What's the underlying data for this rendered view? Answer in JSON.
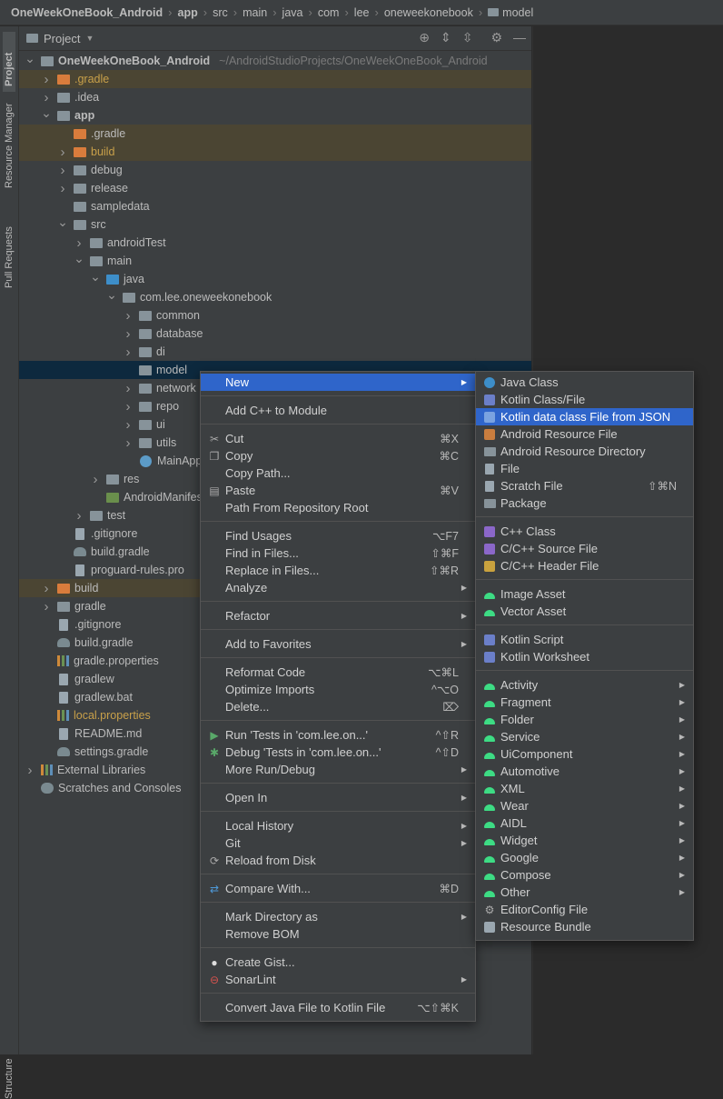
{
  "breadcrumb": [
    "OneWeekOneBook_Android",
    "app",
    "src",
    "main",
    "java",
    "com",
    "lee",
    "oneweekonebook",
    "model"
  ],
  "side_tabs": {
    "project": "Project",
    "resource_manager": "Resource Manager",
    "pull_requests": "Pull Requests",
    "structure": "Structure"
  },
  "panel": {
    "title": "Project"
  },
  "tree": [
    {
      "label": "OneWeekOneBook_Android",
      "extra": "~/AndroidStudioProjects/OneWeekOneBook_Android",
      "indent": 0,
      "arrow": "open",
      "icon": "gray",
      "bold": true
    },
    {
      "label": ".gradle",
      "indent": 1,
      "arrow": "closed",
      "icon": "orange",
      "excluded": true,
      "color": "yellow"
    },
    {
      "label": ".idea",
      "indent": 1,
      "arrow": "closed",
      "icon": "gray"
    },
    {
      "label": "app",
      "indent": 1,
      "arrow": "open",
      "icon": "gray",
      "bold": true
    },
    {
      "label": ".gradle",
      "indent": 2,
      "arrow": "none",
      "icon": "orange",
      "excluded": true
    },
    {
      "label": "build",
      "indent": 2,
      "arrow": "closed",
      "icon": "orange",
      "excluded": true,
      "color": "yellow"
    },
    {
      "label": "debug",
      "indent": 2,
      "arrow": "closed",
      "icon": "gray"
    },
    {
      "label": "release",
      "indent": 2,
      "arrow": "closed",
      "icon": "gray"
    },
    {
      "label": "sampledata",
      "indent": 2,
      "arrow": "none",
      "icon": "gray"
    },
    {
      "label": "src",
      "indent": 2,
      "arrow": "open",
      "icon": "gray"
    },
    {
      "label": "androidTest",
      "indent": 3,
      "arrow": "closed",
      "icon": "gray"
    },
    {
      "label": "main",
      "indent": 3,
      "arrow": "open",
      "icon": "gray"
    },
    {
      "label": "java",
      "indent": 4,
      "arrow": "open",
      "icon": "blue"
    },
    {
      "label": "com.lee.oneweekonebook",
      "indent": 5,
      "arrow": "open",
      "icon": "gray"
    },
    {
      "label": "common",
      "indent": 6,
      "arrow": "closed",
      "icon": "gray"
    },
    {
      "label": "database",
      "indent": 6,
      "arrow": "closed",
      "icon": "gray"
    },
    {
      "label": "di",
      "indent": 6,
      "arrow": "closed",
      "icon": "gray"
    },
    {
      "label": "model",
      "indent": 6,
      "arrow": "none",
      "icon": "gray",
      "selected": true
    },
    {
      "label": "network",
      "indent": 6,
      "arrow": "closed",
      "icon": "gray"
    },
    {
      "label": "repo",
      "indent": 6,
      "arrow": "closed",
      "icon": "gray"
    },
    {
      "label": "ui",
      "indent": 6,
      "arrow": "closed",
      "icon": "gray"
    },
    {
      "label": "utils",
      "indent": 6,
      "arrow": "closed",
      "icon": "gray"
    },
    {
      "label": "MainApp",
      "indent": 6,
      "arrow": "none",
      "icon": "kt"
    },
    {
      "label": "res",
      "indent": 4,
      "arrow": "closed",
      "icon": "gray"
    },
    {
      "label": "AndroidManifes",
      "indent": 4,
      "arrow": "none",
      "icon": "manifest"
    },
    {
      "label": "test",
      "indent": 3,
      "arrow": "closed",
      "icon": "gray"
    },
    {
      "label": ".gitignore",
      "indent": 2,
      "arrow": "none",
      "icon": "file"
    },
    {
      "label": "build.gradle",
      "indent": 2,
      "arrow": "none",
      "icon": "elephant"
    },
    {
      "label": "proguard-rules.pro",
      "indent": 2,
      "arrow": "none",
      "icon": "file"
    },
    {
      "label": "build",
      "indent": 1,
      "arrow": "closed",
      "icon": "orange",
      "excluded": true
    },
    {
      "label": "gradle",
      "indent": 1,
      "arrow": "closed",
      "icon": "gray"
    },
    {
      "label": ".gitignore",
      "indent": 1,
      "arrow": "none",
      "icon": "file"
    },
    {
      "label": "build.gradle",
      "indent": 1,
      "arrow": "none",
      "icon": "elephant"
    },
    {
      "label": "gradle.properties",
      "indent": 1,
      "arrow": "none",
      "icon": "bars"
    },
    {
      "label": "gradlew",
      "indent": 1,
      "arrow": "none",
      "icon": "file"
    },
    {
      "label": "gradlew.bat",
      "indent": 1,
      "arrow": "none",
      "icon": "file"
    },
    {
      "label": "local.properties",
      "indent": 1,
      "arrow": "none",
      "icon": "bars",
      "color": "yellow"
    },
    {
      "label": "README.md",
      "indent": 1,
      "arrow": "none",
      "icon": "file"
    },
    {
      "label": "settings.gradle",
      "indent": 1,
      "arrow": "none",
      "icon": "elephant"
    },
    {
      "label": "External Libraries",
      "indent": 0,
      "arrow": "closed",
      "icon": "bars"
    },
    {
      "label": "Scratches and Consoles",
      "indent": 0,
      "arrow": "none",
      "icon": "scratch"
    }
  ],
  "context_menu": [
    {
      "label": "New",
      "submenu": true,
      "active": true
    },
    {
      "sep": true
    },
    {
      "label": "Add C++ to Module"
    },
    {
      "sep": true
    },
    {
      "label": "Cut",
      "shortcut": "⌘X",
      "icon": "✂"
    },
    {
      "label": "Copy",
      "shortcut": "⌘C",
      "icon": "❐"
    },
    {
      "label": "Copy Path..."
    },
    {
      "label": "Paste",
      "shortcut": "⌘V",
      "icon": "▤"
    },
    {
      "label": "Path From Repository Root"
    },
    {
      "sep": true
    },
    {
      "label": "Find Usages",
      "shortcut": "⌥F7"
    },
    {
      "label": "Find in Files...",
      "shortcut": "⇧⌘F"
    },
    {
      "label": "Replace in Files...",
      "shortcut": "⇧⌘R"
    },
    {
      "label": "Analyze",
      "submenu": true
    },
    {
      "sep": true
    },
    {
      "label": "Refactor",
      "submenu": true
    },
    {
      "sep": true
    },
    {
      "label": "Add to Favorites",
      "submenu": true
    },
    {
      "sep": true
    },
    {
      "label": "Reformat Code",
      "shortcut": "⌥⌘L"
    },
    {
      "label": "Optimize Imports",
      "shortcut": "^⌥O"
    },
    {
      "label": "Delete...",
      "shortcut": "⌦"
    },
    {
      "sep": true
    },
    {
      "label": "Run 'Tests in 'com.lee.on...'",
      "shortcut": "^⇧R",
      "icon": "▶",
      "iconColor": "#59a869"
    },
    {
      "label": "Debug 'Tests in 'com.lee.on...'",
      "shortcut": "^⇧D",
      "icon": "✱",
      "iconColor": "#59a869"
    },
    {
      "label": "More Run/Debug",
      "submenu": true
    },
    {
      "sep": true
    },
    {
      "label": "Open In",
      "submenu": true
    },
    {
      "sep": true
    },
    {
      "label": "Local History",
      "submenu": true
    },
    {
      "label": "Git",
      "submenu": true
    },
    {
      "label": "Reload from Disk",
      "icon": "⟳"
    },
    {
      "sep": true
    },
    {
      "label": "Compare With...",
      "shortcut": "⌘D",
      "icon": "⇄",
      "iconColor": "#4e9ad9"
    },
    {
      "sep": true
    },
    {
      "label": "Mark Directory as",
      "submenu": true
    },
    {
      "label": "Remove BOM"
    },
    {
      "sep": true
    },
    {
      "label": "Create Gist...",
      "icon": "●",
      "iconColor": "#dddddd"
    },
    {
      "label": "SonarLint",
      "submenu": true,
      "icon": "⊖",
      "iconColor": "#d9534f"
    },
    {
      "sep": true
    },
    {
      "label": "Convert Java File to Kotlin File",
      "shortcut": "⌥⇧⌘K"
    }
  ],
  "new_submenu": [
    {
      "label": "Java Class",
      "icon": "circle",
      "iconColor": "#3d8ec9"
    },
    {
      "label": "Kotlin Class/File",
      "icon": "square",
      "iconColor": "#6b7fc9"
    },
    {
      "label": "Kotlin data class File from JSON",
      "icon": "square",
      "iconColor": "#7aa3e0",
      "active": true
    },
    {
      "label": "Android Resource File",
      "icon": "square",
      "iconColor": "#c97d3e"
    },
    {
      "label": "Android Resource Directory",
      "icon": "folder"
    },
    {
      "label": "File",
      "icon": "file"
    },
    {
      "label": "Scratch File",
      "icon": "file",
      "shortcut": "⇧⌘N"
    },
    {
      "label": "Package",
      "icon": "folder"
    },
    {
      "sep": true
    },
    {
      "label": "C++ Class",
      "icon": "square",
      "iconColor": "#8b67c9"
    },
    {
      "label": "C/C++ Source File",
      "icon": "square",
      "iconColor": "#8b67c9"
    },
    {
      "label": "C/C++ Header File",
      "icon": "square",
      "iconColor": "#c9a23e"
    },
    {
      "sep": true
    },
    {
      "label": "Image Asset",
      "icon": "android"
    },
    {
      "label": "Vector Asset",
      "icon": "android"
    },
    {
      "sep": true
    },
    {
      "label": "Kotlin Script",
      "icon": "square",
      "iconColor": "#6b7fc9"
    },
    {
      "label": "Kotlin Worksheet",
      "icon": "square",
      "iconColor": "#6b7fc9"
    },
    {
      "sep": true
    },
    {
      "label": "Activity",
      "icon": "android",
      "submenu": true
    },
    {
      "label": "Fragment",
      "icon": "android",
      "submenu": true
    },
    {
      "label": "Folder",
      "icon": "android",
      "submenu": true
    },
    {
      "label": "Service",
      "icon": "android",
      "submenu": true
    },
    {
      "label": "UiComponent",
      "icon": "android",
      "submenu": true
    },
    {
      "label": "Automotive",
      "icon": "android",
      "submenu": true
    },
    {
      "label": "XML",
      "icon": "android",
      "submenu": true
    },
    {
      "label": "Wear",
      "icon": "android",
      "submenu": true
    },
    {
      "label": "AIDL",
      "icon": "android",
      "submenu": true
    },
    {
      "label": "Widget",
      "icon": "android",
      "submenu": true
    },
    {
      "label": "Google",
      "icon": "android",
      "submenu": true
    },
    {
      "label": "Compose",
      "icon": "android",
      "submenu": true
    },
    {
      "label": "Other",
      "icon": "android",
      "submenu": true
    },
    {
      "label": "EditorConfig File",
      "icon": "gear"
    },
    {
      "label": "Resource Bundle",
      "icon": "square",
      "iconColor": "#9aa7b0"
    }
  ]
}
